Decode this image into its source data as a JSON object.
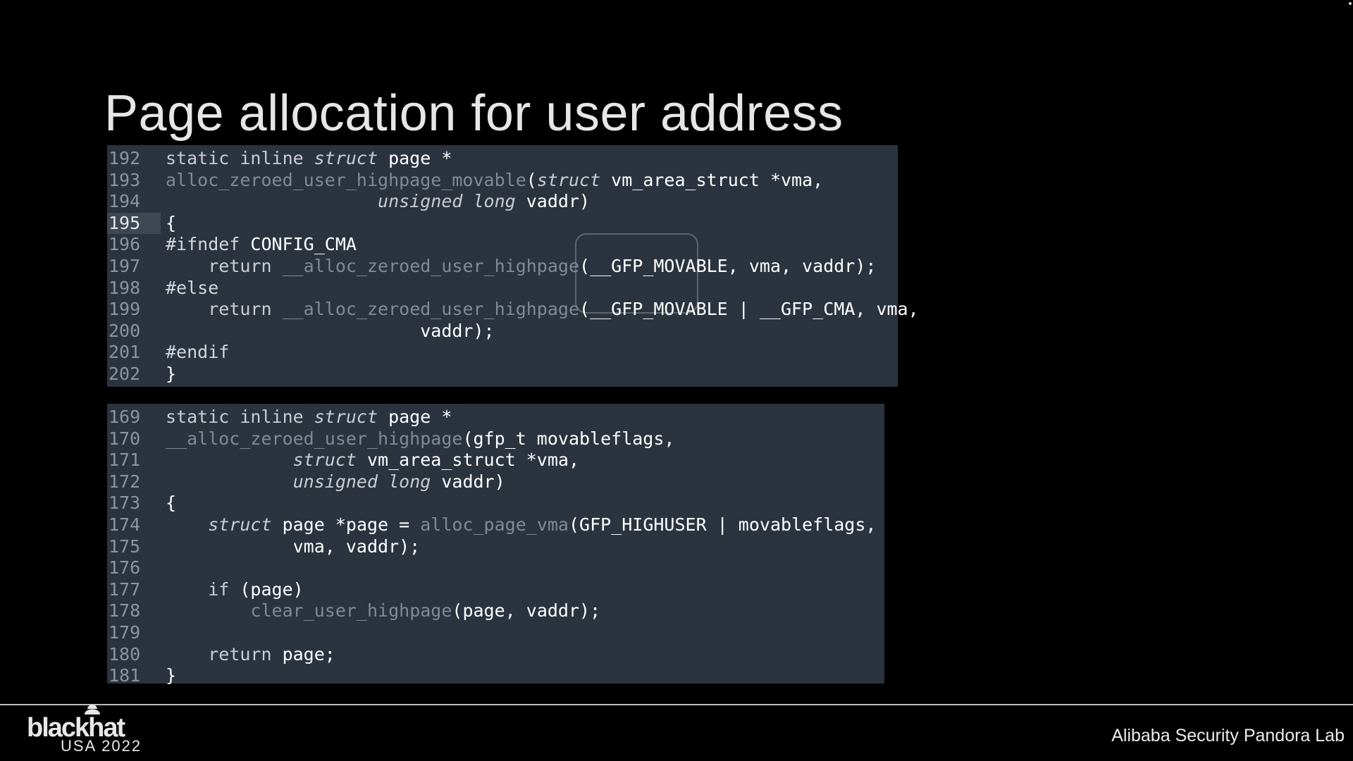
{
  "slide": {
    "title": "Page allocation for user address",
    "footer_right": "Alibaba Security Pandora Lab",
    "logo": {
      "word": "blackhat",
      "sub": "USA 2022",
      "icon": "hat-logo-icon"
    }
  },
  "colors": {
    "background": "#000000",
    "code_panel": "#2b333e",
    "line_number": "#8c949e",
    "function_name": "#7f8a99"
  },
  "code_panel_1": {
    "current_line": "195",
    "highlighted_token": "__GFP_MOVABLE",
    "lines": [
      {
        "n": "192",
        "t": [
          [
            "kw",
            "static inline "
          ],
          [
            "type",
            "struct"
          ],
          [
            "plain",
            " page *"
          ]
        ]
      },
      {
        "n": "193",
        "t": [
          [
            "fn",
            "alloc_zeroed_user_highpage_movable"
          ],
          [
            "plain",
            "("
          ],
          [
            "type",
            "struct"
          ],
          [
            "plain",
            " vm_area_struct *vma,"
          ]
        ]
      },
      {
        "n": "194",
        "t": [
          [
            "plain",
            "                    "
          ],
          [
            "type",
            "unsigned long"
          ],
          [
            "plain",
            " vaddr)"
          ]
        ]
      },
      {
        "n": "195",
        "t": [
          [
            "plain",
            "{"
          ]
        ]
      },
      {
        "n": "196",
        "t": [
          [
            "pre",
            "#ifndef"
          ],
          [
            "plain",
            " CONFIG_CMA"
          ]
        ]
      },
      {
        "n": "197",
        "t": [
          [
            "plain",
            "    "
          ],
          [
            "kw",
            "return "
          ],
          [
            "fn",
            "__alloc_zeroed_user_highpage"
          ],
          [
            "plain",
            "(__GFP_MOVABLE, vma, vaddr);"
          ]
        ]
      },
      {
        "n": "198",
        "t": [
          [
            "pre",
            "#else"
          ]
        ]
      },
      {
        "n": "199",
        "t": [
          [
            "plain",
            "    "
          ],
          [
            "kw",
            "return "
          ],
          [
            "fn",
            "__alloc_zeroed_user_highpage"
          ],
          [
            "plain",
            "(__GFP_MOVABLE | __GFP_CMA, vma,"
          ]
        ]
      },
      {
        "n": "200",
        "t": [
          [
            "plain",
            "                        vaddr);"
          ]
        ]
      },
      {
        "n": "201",
        "t": [
          [
            "pre",
            "#endif"
          ]
        ]
      },
      {
        "n": "202",
        "t": [
          [
            "plain",
            "}"
          ]
        ]
      }
    ]
  },
  "code_panel_2": {
    "lines": [
      {
        "n": "169",
        "t": [
          [
            "kw",
            "static inline "
          ],
          [
            "type",
            "struct"
          ],
          [
            "plain",
            " page *"
          ]
        ]
      },
      {
        "n": "170",
        "t": [
          [
            "fn",
            "__alloc_zeroed_user_highpage"
          ],
          [
            "plain",
            "(gfp_t movableflags,"
          ]
        ]
      },
      {
        "n": "171",
        "t": [
          [
            "plain",
            "            "
          ],
          [
            "type",
            "struct"
          ],
          [
            "plain",
            " vm_area_struct *vma,"
          ]
        ]
      },
      {
        "n": "172",
        "t": [
          [
            "plain",
            "            "
          ],
          [
            "type",
            "unsigned long"
          ],
          [
            "plain",
            " vaddr)"
          ]
        ]
      },
      {
        "n": "173",
        "t": [
          [
            "plain",
            "{"
          ]
        ]
      },
      {
        "n": "174",
        "t": [
          [
            "plain",
            "    "
          ],
          [
            "type",
            "struct"
          ],
          [
            "plain",
            " page *page = "
          ],
          [
            "fn",
            "alloc_page_vma"
          ],
          [
            "plain",
            "(GFP_HIGHUSER | movableflags,"
          ]
        ]
      },
      {
        "n": "175",
        "t": [
          [
            "plain",
            "            vma, vaddr);"
          ]
        ]
      },
      {
        "n": "176",
        "t": []
      },
      {
        "n": "177",
        "t": [
          [
            "plain",
            "    "
          ],
          [
            "kw",
            "if"
          ],
          [
            "plain",
            " (page)"
          ]
        ]
      },
      {
        "n": "178",
        "t": [
          [
            "plain",
            "        "
          ],
          [
            "fn",
            "clear_user_highpage"
          ],
          [
            "plain",
            "(page, vaddr);"
          ]
        ]
      },
      {
        "n": "179",
        "t": []
      },
      {
        "n": "180",
        "t": [
          [
            "plain",
            "    "
          ],
          [
            "kw",
            "return"
          ],
          [
            "plain",
            " page;"
          ]
        ]
      },
      {
        "n": "181",
        "t": [
          [
            "plain",
            "}"
          ]
        ]
      }
    ]
  }
}
